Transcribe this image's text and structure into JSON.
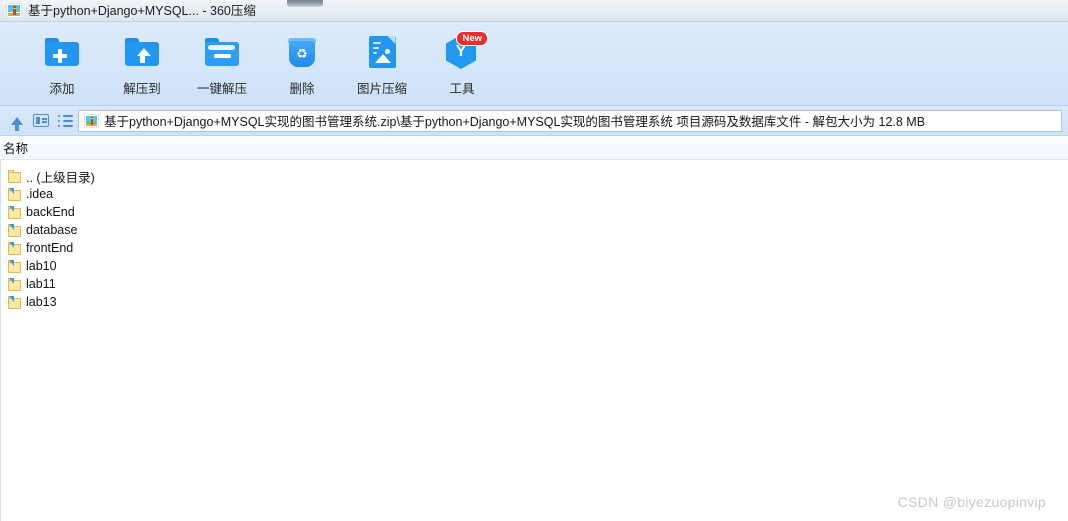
{
  "window": {
    "title": "基于python+Django+MYSQL... - 360压缩",
    "app_icon": "archive-picture-icon"
  },
  "toolbar": {
    "buttons": [
      {
        "label": "添加",
        "icon": "folder-add-icon"
      },
      {
        "label": "解压到",
        "icon": "folder-extract-to-icon"
      },
      {
        "label": "一键解压",
        "icon": "folder-one-click-extract-icon"
      },
      {
        "label": "删除",
        "icon": "trash-recycle-icon"
      },
      {
        "label": "图片压缩",
        "icon": "image-compress-icon"
      },
      {
        "label": "工具",
        "icon": "tools-hexagon-icon",
        "badge": "New"
      }
    ]
  },
  "addressbar": {
    "nav": [
      {
        "icon": "up-arrow-icon"
      },
      {
        "icon": "panel-view-icon"
      },
      {
        "icon": "list-view-icon"
      }
    ],
    "path_icon": "archive-picture-icon",
    "path": "基于python+Django+MYSQL实现的图书管理系统.zip\\基于python+Django+MYSQL实现的图书管理系统 项目源码及数据库文件 - 解包大小为 12.8 MB"
  },
  "list": {
    "columns": [
      "名称"
    ],
    "rows": [
      {
        "name": ".. (上级目录)",
        "icon": "folder-parent-icon",
        "badge": false
      },
      {
        "name": ".idea",
        "icon": "folder-icon",
        "badge": true
      },
      {
        "name": "backEnd",
        "icon": "folder-icon",
        "badge": true
      },
      {
        "name": "database",
        "icon": "folder-icon",
        "badge": true
      },
      {
        "name": "frontEnd",
        "icon": "folder-icon",
        "badge": true
      },
      {
        "name": "lab10",
        "icon": "folder-icon",
        "badge": true
      },
      {
        "name": "lab11",
        "icon": "folder-icon",
        "badge": true
      },
      {
        "name": "lab13",
        "icon": "folder-icon",
        "badge": true
      }
    ]
  },
  "watermark": {
    "text": "CSDN @biyezuopinvip"
  },
  "colors": {
    "toolbar_blue": "#d5e6fa",
    "icon_blue": "#2196f3",
    "badge_red": "#ee2b2b",
    "folder_yellow": "#fde8a5",
    "watermark_gray": "#c9c9c9"
  }
}
